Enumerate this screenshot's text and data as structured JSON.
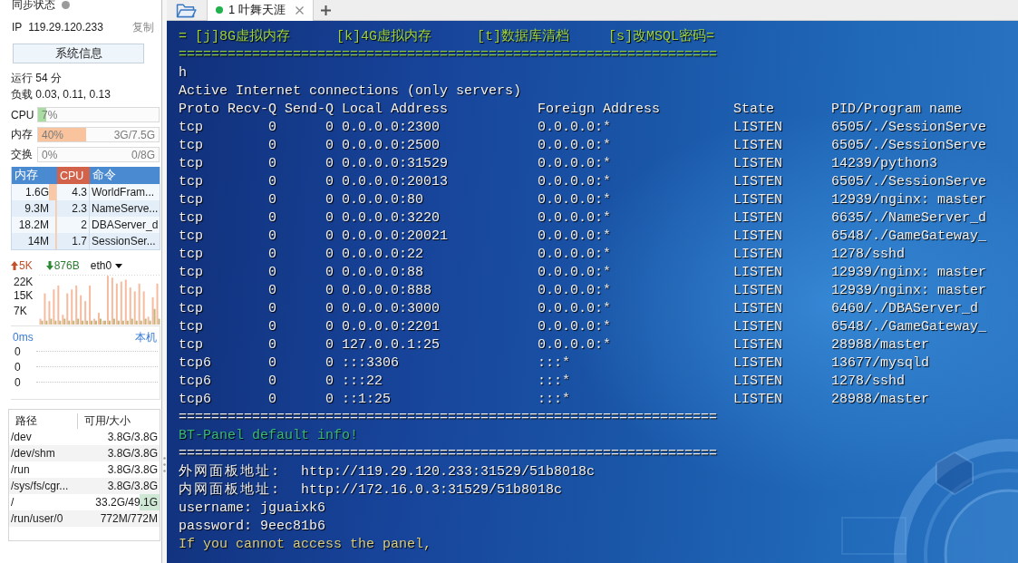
{
  "sidebar": {
    "sync_label": "同步状态",
    "ip_label": "IP",
    "ip_address": "119.29.120.233",
    "copy_link": "复制",
    "sysinfo_button": "系统信息",
    "uptime": "运行 54 分",
    "load": "负载 0.03, 0.11, 0.13",
    "meters": [
      {
        "label": "CPU",
        "reading": "7%",
        "level": 0.07,
        "color": "#a9dca3"
      },
      {
        "label": "内存",
        "reading": "40%",
        "detail": "3G/7.5G",
        "level": 0.4,
        "color": "#f9c49d"
      },
      {
        "label": "交换",
        "reading": "0%",
        "detail": "0/8G"
      }
    ],
    "processes": {
      "columns": [
        {
          "label": "内存",
          "selected": false
        },
        {
          "label": "CPU",
          "selected": true
        },
        {
          "label": "命令",
          "selected": false
        }
      ],
      "rows": [
        {
          "memory": "1.6G",
          "cpu": "4.3",
          "command": "WorldFram...",
          "level": 0.17
        },
        {
          "memory": "9.3M",
          "cpu": "2.3",
          "command": "NameServe...",
          "level": 0.02
        },
        {
          "memory": "18.2M",
          "cpu": "2",
          "command": "DBAServer_d",
          "level": 0.02
        },
        {
          "memory": "14M",
          "cpu": "1.7",
          "command": "SessionSer...",
          "level": 0.02
        }
      ]
    },
    "network": {
      "upload": "5K",
      "download": "876B",
      "interface": "eth0",
      "chart_data": {
        "type": "bar",
        "categories": [
          null,
          null,
          null,
          null,
          null,
          null,
          null,
          null,
          null,
          null,
          null,
          null,
          null,
          null,
          null,
          null,
          null,
          null,
          null,
          null,
          null,
          null,
          null,
          null,
          null,
          null,
          null
        ],
        "ylim": [
          0,
          26
        ],
        "yticks": [
          {
            "value": 7,
            "label": "7K"
          },
          {
            "value": 15,
            "label": "15K"
          },
          {
            "value": 22,
            "label": "22K"
          }
        ],
        "series": [
          {
            "color": "#f6bb9e",
            "values": [
              3,
              16,
              12,
              18,
              20,
              5,
              16,
              18,
              20,
              15,
              12,
              20,
              3,
              6,
              2,
              25,
              24,
              21,
              22,
              23,
              19,
              17,
              21,
              17,
              4,
              14,
              21
            ]
          },
          {
            "color": "#c2b47a",
            "values": [
              2,
              2,
              3,
              2,
              2,
              3,
              2,
              2,
              3,
              2,
              2,
              2,
              2,
              3,
              2,
              2,
              3,
              2,
              2,
              2,
              3,
              2,
              2,
              3,
              2,
              8,
              3
            ]
          }
        ]
      }
    },
    "latency": {
      "reading": "0ms",
      "host_link": "本机",
      "scale": [
        "0",
        "0",
        "0"
      ]
    },
    "disks": {
      "columns": [
        "路径",
        "可用/大小"
      ],
      "rows": [
        {
          "path": "/dev",
          "space": "3.8G/3.8G"
        },
        {
          "path": "/dev/shm",
          "space": "3.8G/3.8G"
        },
        {
          "path": "/run",
          "space": "3.8G/3.8G"
        },
        {
          "path": "/sys/fs/cgr...",
          "space": "3.8G/3.8G"
        },
        {
          "path": "/",
          "space": "33.2G/49.1G",
          "level": 0.27
        },
        {
          "path": "/run/user/0",
          "space": "772M/772M"
        }
      ]
    }
  },
  "tabs": [
    {
      "label": "1 叶舞天涯",
      "selected": true,
      "connected": true
    }
  ],
  "terminal": {
    "lines": [
      {
        "kind": "menu",
        "color": "#9cd23e",
        "items": [
          "= [j]8G虚拟内存",
          "[k]4G虚拟内存",
          "[t]数据库清档",
          "[s]改MSQL密码="
        ]
      },
      {
        "kind": "text",
        "color": "#8fd04a",
        "text": "=================================================================="
      },
      {
        "kind": "text",
        "text": "h"
      },
      {
        "kind": "text",
        "text": "Active Internet connections (only servers)"
      },
      {
        "kind": "table",
        "columns": [
          "Proto",
          "Recv-Q",
          "Send-Q",
          "Local Address",
          "Foreign Address",
          "State",
          "PID/Program name"
        ],
        "rows": [
          [
            "tcp",
            "0",
            "0",
            "0.0.0.0:2300",
            "0.0.0.0:*",
            "LISTEN",
            "6505/./SessionServe"
          ],
          [
            "tcp",
            "0",
            "0",
            "0.0.0.0:2500",
            "0.0.0.0:*",
            "LISTEN",
            "6505/./SessionServe"
          ],
          [
            "tcp",
            "0",
            "0",
            "0.0.0.0:31529",
            "0.0.0.0:*",
            "LISTEN",
            "14239/python3"
          ],
          [
            "tcp",
            "0",
            "0",
            "0.0.0.0:20013",
            "0.0.0.0:*",
            "LISTEN",
            "6505/./SessionServe"
          ],
          [
            "tcp",
            "0",
            "0",
            "0.0.0.0:80",
            "0.0.0.0:*",
            "LISTEN",
            "12939/nginx: master"
          ],
          [
            "tcp",
            "0",
            "0",
            "0.0.0.0:3220",
            "0.0.0.0:*",
            "LISTEN",
            "6635/./NameServer_d"
          ],
          [
            "tcp",
            "0",
            "0",
            "0.0.0.0:20021",
            "0.0.0.0:*",
            "LISTEN",
            "6548/./GameGateway_"
          ],
          [
            "tcp",
            "0",
            "0",
            "0.0.0.0:22",
            "0.0.0.0:*",
            "LISTEN",
            "1278/sshd"
          ],
          [
            "tcp",
            "0",
            "0",
            "0.0.0.0:88",
            "0.0.0.0:*",
            "LISTEN",
            "12939/nginx: master"
          ],
          [
            "tcp",
            "0",
            "0",
            "0.0.0.0:888",
            "0.0.0.0:*",
            "LISTEN",
            "12939/nginx: master"
          ],
          [
            "tcp",
            "0",
            "0",
            "0.0.0.0:3000",
            "0.0.0.0:*",
            "LISTEN",
            "6460/./DBAServer_d"
          ],
          [
            "tcp",
            "0",
            "0",
            "0.0.0.0:2201",
            "0.0.0.0:*",
            "LISTEN",
            "6548/./GameGateway_"
          ],
          [
            "tcp",
            "0",
            "0",
            "127.0.0.1:25",
            "0.0.0.0:*",
            "LISTEN",
            "28988/master"
          ],
          [
            "tcp6",
            "0",
            "0",
            ":::3306",
            ":::*",
            "LISTEN",
            "13677/mysqld"
          ],
          [
            "tcp6",
            "0",
            "0",
            ":::22",
            ":::*",
            "LISTEN",
            "1278/sshd"
          ],
          [
            "tcp6",
            "0",
            "0",
            "::1:25",
            ":::*",
            "LISTEN",
            "28988/master"
          ]
        ]
      },
      {
        "kind": "text",
        "text": "=================================================================="
      },
      {
        "kind": "text",
        "color": "#3cb878",
        "text": "BT-Panel default info!"
      },
      {
        "kind": "text",
        "text": "=================================================================="
      },
      {
        "kind": "field",
        "label": "外网面板地址:",
        "value": "http://119.29.120.233:31529/51b8018c"
      },
      {
        "kind": "field",
        "label": "内网面板地址:",
        "value": "http://172.16.0.3:31529/51b8018c"
      },
      {
        "kind": "text",
        "text": "username: jguaixk6"
      },
      {
        "kind": "text",
        "text": "password: 9eec81b6"
      },
      {
        "kind": "text",
        "color": "#d6cc82",
        "text": "If you cannot access the panel,"
      }
    ]
  }
}
